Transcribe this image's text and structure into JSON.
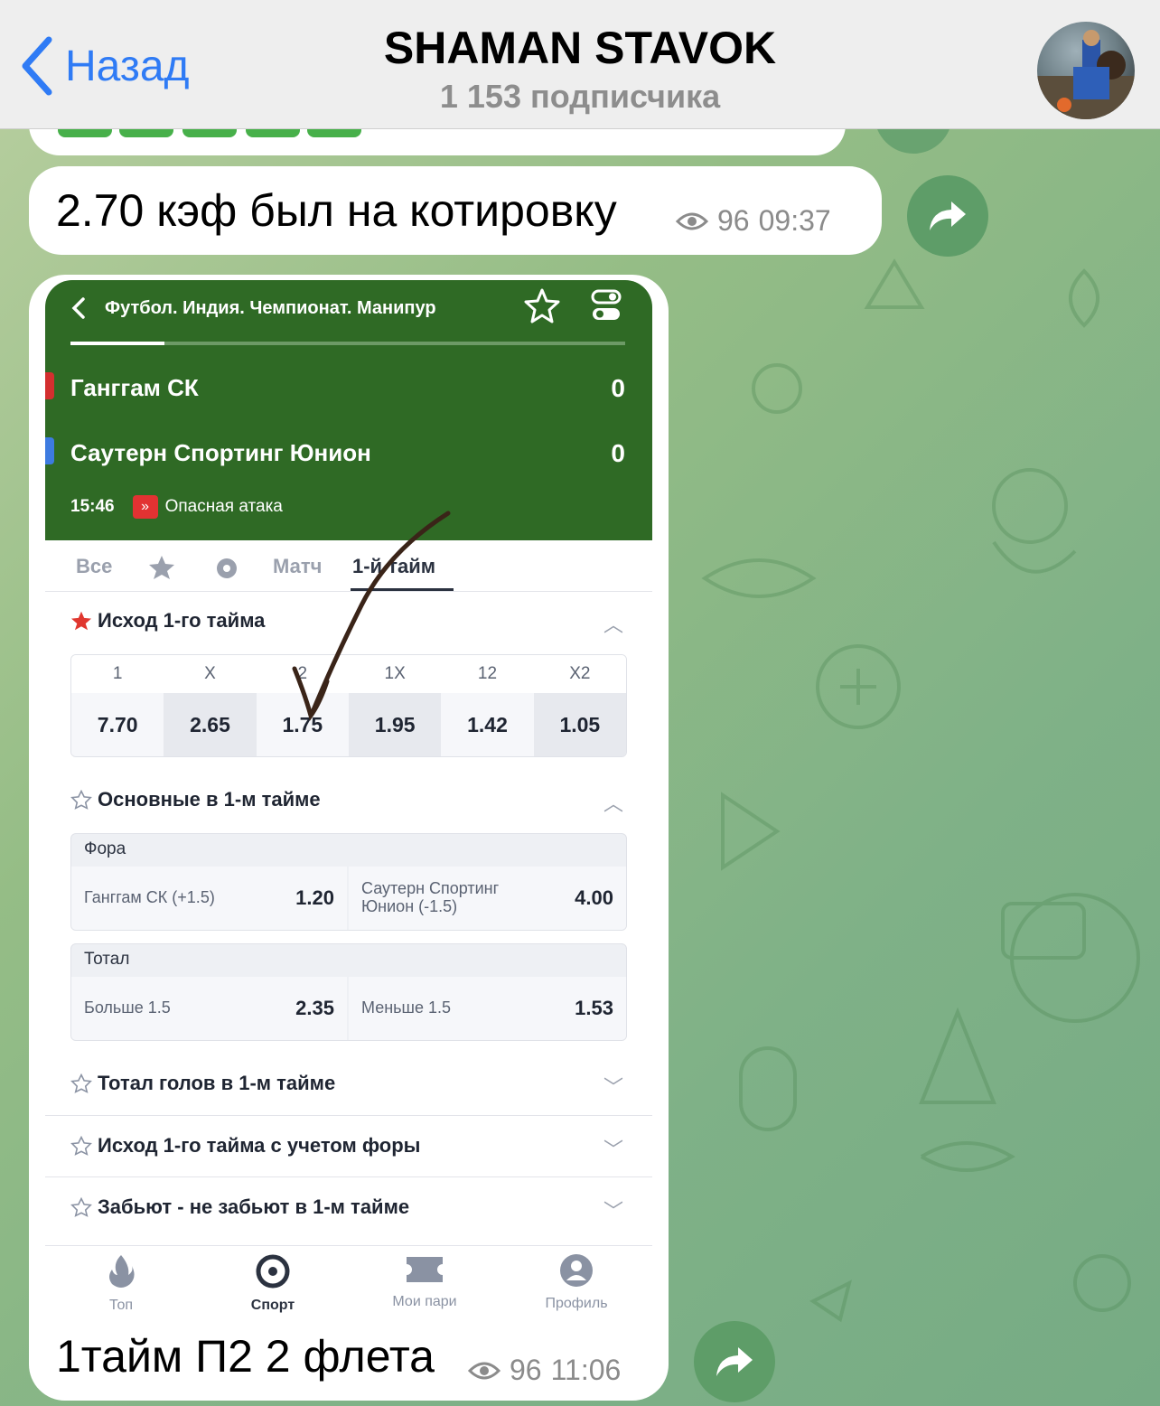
{
  "header": {
    "back_label": "Назад",
    "title": "SHAMAN STAVOK",
    "subtitle": "1 153 подписчика"
  },
  "messages": [
    {
      "text": "2.70 кэф был на котировку",
      "views": "96",
      "time": "09:37"
    },
    {
      "text": "1тайм П2 2 флета",
      "views": "96",
      "time": "11:06"
    }
  ],
  "screenshot": {
    "breadcrumb": "Футбол. Индия. Чемпионат. Манипур",
    "progress_fraction": 0.17,
    "team1": {
      "name": "Ганггам СК",
      "score": "0",
      "color": "#d32f2f"
    },
    "team2": {
      "name": "Саутерн Спортинг Юнион",
      "score": "0",
      "color": "#3d7be0"
    },
    "live_time": "15:46",
    "live_status": "Опасная атака",
    "tabs": [
      "Все",
      "Матч",
      "1-й тайм"
    ],
    "active_tab": "1-й тайм",
    "section1": {
      "title": "Исход 1-го тайма",
      "labels": [
        "1",
        "X",
        "2",
        "1X",
        "12",
        "X2"
      ],
      "values": [
        "7.70",
        "2.65",
        "1.75",
        "1.95",
        "1.42",
        "1.05"
      ]
    },
    "section2": {
      "title": "Основные в 1-м тайме",
      "handicap": {
        "title": "Фора",
        "left_name": "Ганггам СК (+1.5)",
        "left_value": "1.20",
        "right_name_line1": "Саутерн Спортинг",
        "right_name_line2": "Юнион (-1.5)",
        "right_value": "4.00"
      },
      "total": {
        "title": "Тотал",
        "left_name": "Больше 1.5",
        "left_value": "2.35",
        "right_name": "Меньше 1.5",
        "right_value": "1.53"
      }
    },
    "collapsed_sections": [
      "Тотал голов в 1-м тайме",
      "Исход 1-го тайма с учетом форы",
      "Забьют - не забьют в 1-м тайме"
    ],
    "nav": [
      "Топ",
      "Спорт",
      "Мои пари",
      "Профиль"
    ],
    "nav_active": "Спорт"
  }
}
